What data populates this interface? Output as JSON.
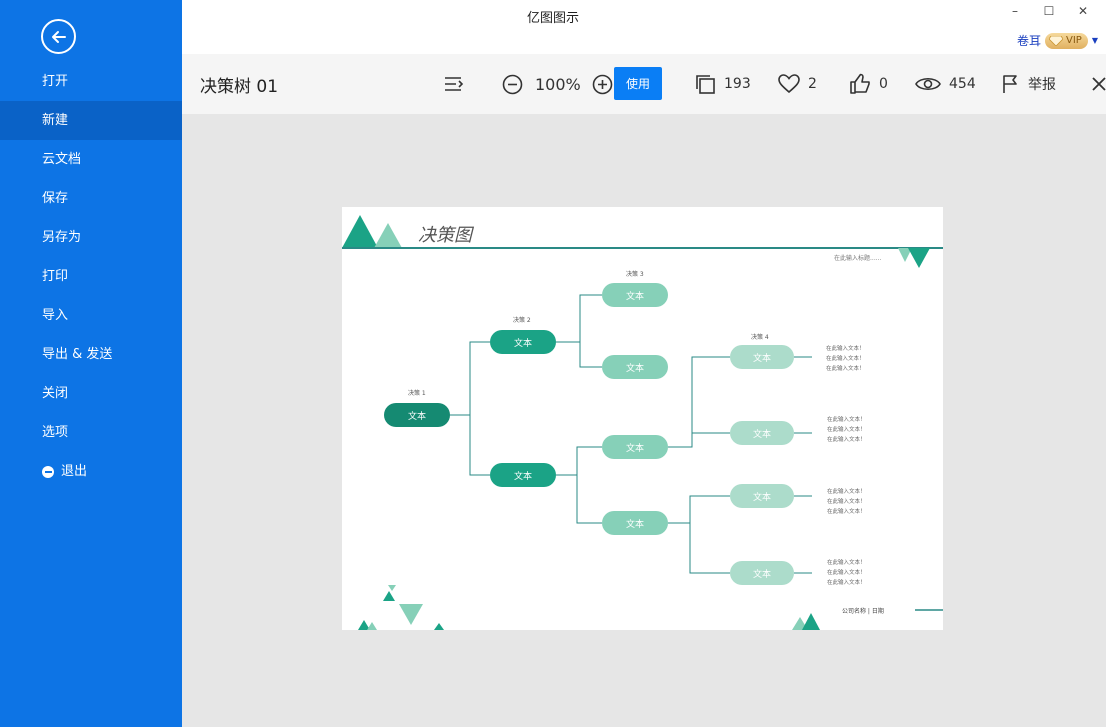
{
  "window": {
    "title": "亿图图示",
    "minimize": "–",
    "maximize": "☐",
    "close": "✕"
  },
  "user": {
    "name": "卷耳",
    "vip": "VIP"
  },
  "sidebar": {
    "items": [
      {
        "label": "打开"
      },
      {
        "label": "新建"
      },
      {
        "label": "云文档"
      },
      {
        "label": "保存"
      },
      {
        "label": "另存为"
      },
      {
        "label": "打印"
      },
      {
        "label": "导入"
      },
      {
        "label": "导出 & 发送"
      },
      {
        "label": "关闭"
      },
      {
        "label": "选项"
      },
      {
        "label": "退出"
      }
    ]
  },
  "toolbar": {
    "doc_title": "决策树 01",
    "zoom": "100%",
    "use_label": "使用",
    "copies": "193",
    "likes": "2",
    "thumbs": "0",
    "views": "454",
    "report": "举报"
  },
  "diagram": {
    "title": "决策图",
    "subtitle": "在此输入标题......",
    "footer": "公司名称 | 日期",
    "labels": {
      "d1": "决策 1",
      "d2": "决策 2",
      "d3": "决策 3",
      "d4": "决策 4"
    },
    "node_text": "文本",
    "leaf_text": "在此输入文本！",
    "colors": {
      "dark": "#158a72",
      "mid": "#1ba386",
      "light": "#86d0b8",
      "pale": "#acdccb",
      "line": "#2a8a86"
    }
  }
}
